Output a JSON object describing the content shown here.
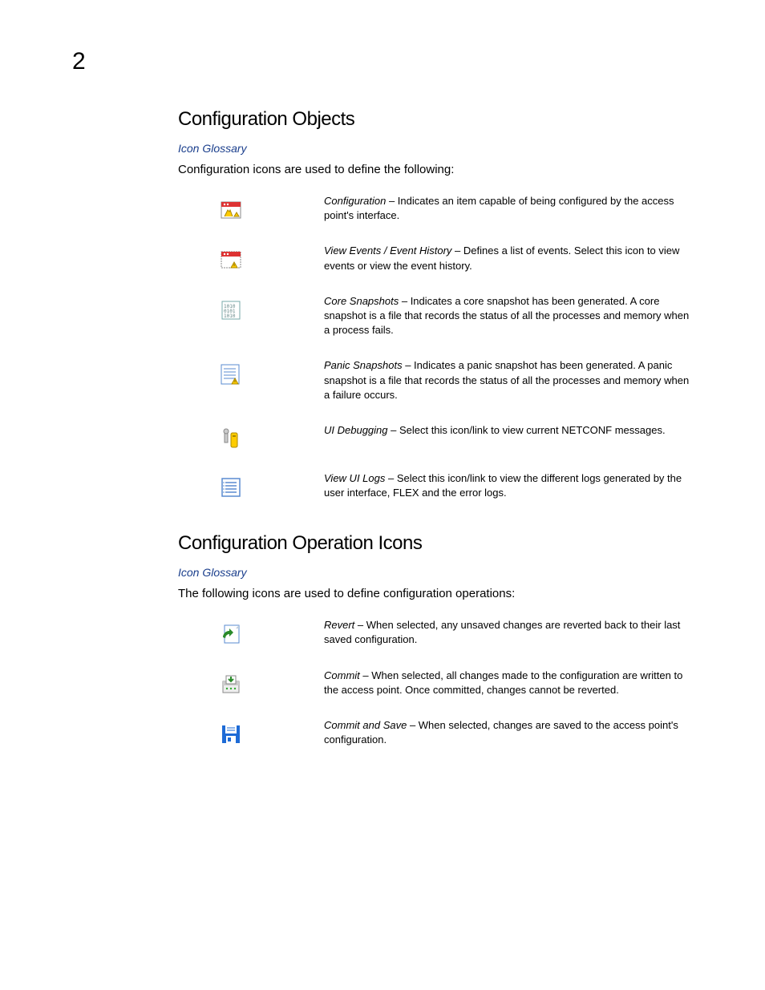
{
  "page_number": "2",
  "sections": [
    {
      "heading": "Configuration Objects",
      "breadcrumb": "Icon Glossary",
      "intro": "Configuration icons are used to define the following:",
      "items": [
        {
          "icon": "configuration-icon",
          "term": "Configuration",
          "desc": " – Indicates an item capable of being configured by the access point's interface."
        },
        {
          "icon": "view-events-icon",
          "term": "View Events / Event History",
          "desc": " – Defines a list of events. Select this icon to view events or view the event history."
        },
        {
          "icon": "core-snapshots-icon",
          "term": "Core Snapshots",
          "desc": " – Indicates a core snapshot has been generated. A core snapshot is a file that records the status of all the processes and memory when a process fails."
        },
        {
          "icon": "panic-snapshots-icon",
          "term": "Panic Snapshots",
          "desc": " – Indicates a panic snapshot has been generated. A panic snapshot is a file that records the status of all the processes and memory when a failure occurs."
        },
        {
          "icon": "ui-debugging-icon",
          "term": "UI Debugging",
          "desc": " – Select this icon/link to view current NETCONF messages."
        },
        {
          "icon": "view-ui-logs-icon",
          "term": "View UI Logs",
          "desc": " – Select this icon/link to view the different logs generated by the user interface, FLEX and the error logs."
        }
      ]
    },
    {
      "heading": "Configuration Operation Icons",
      "breadcrumb": "Icon Glossary",
      "intro": "The following icons are used to define configuration operations:",
      "items": [
        {
          "icon": "revert-icon",
          "term": "Revert",
          "desc": " – When selected, any unsaved changes are reverted back to their last saved configuration."
        },
        {
          "icon": "commit-icon",
          "term": "Commit",
          "desc": " – When selected, all changes made to the configuration are written to the access point. Once committed, changes cannot be reverted."
        },
        {
          "icon": "commit-and-save-icon",
          "term": "Commit and Save",
          "desc": " – When selected, changes are saved to the access point's configuration."
        }
      ]
    }
  ]
}
